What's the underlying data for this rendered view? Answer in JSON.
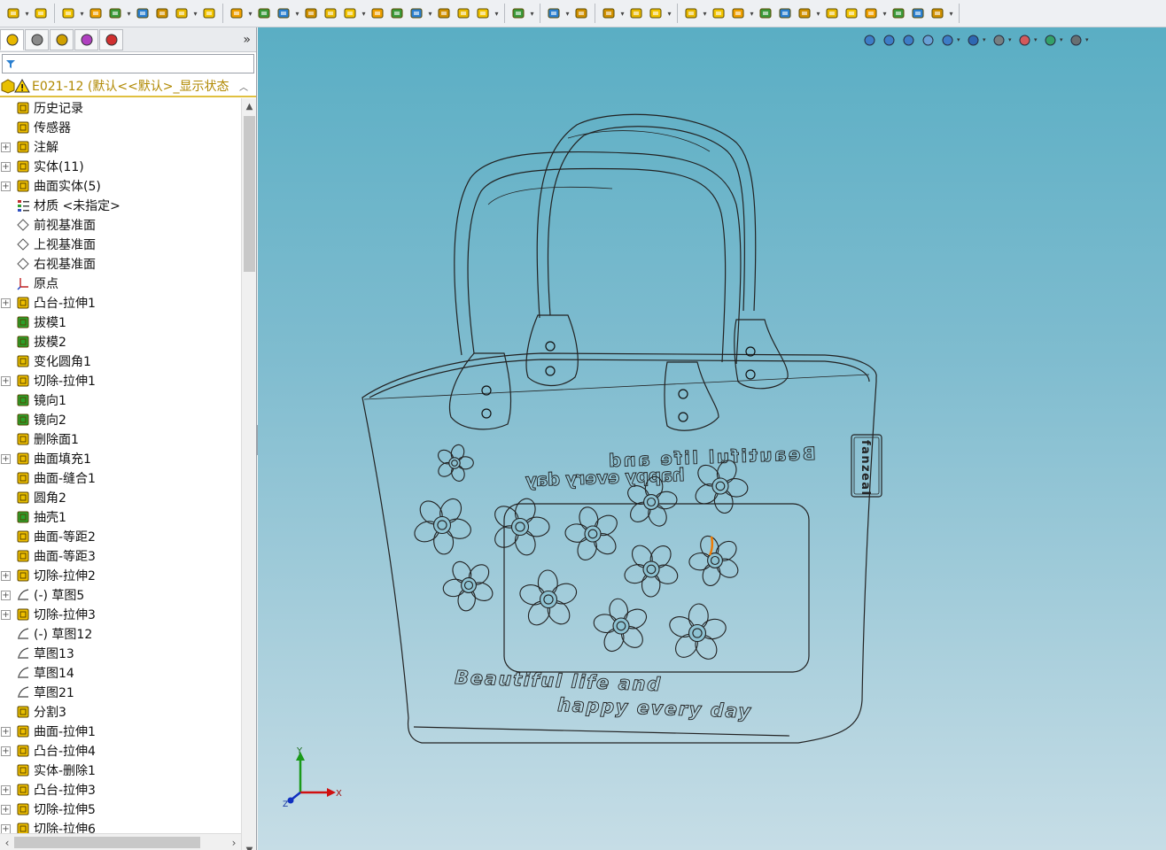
{
  "window": {
    "colors": {
      "viewport_top": "#5aaec4",
      "viewport_bottom": "#c6dde6",
      "root_text": "#b08800",
      "accent_yellow": "#e8c000"
    }
  },
  "toolbar": {
    "groups": [
      [
        "new-document-icon",
        "open-document-icon"
      ],
      [
        "sketch-point-icon",
        "extrude-boss-icon",
        "revolve-boss-icon",
        "sweep-boss-icon",
        "loft-boss-icon",
        "boundary-boss-icon",
        "fillet-icon"
      ],
      [
        "chamfer-icon",
        "rib-icon",
        "shell-icon",
        "draft-icon",
        "dome-icon",
        "wrap-icon",
        "intersect-icon",
        "cut-extrude-icon",
        "cut-revolve-icon",
        "hole-wizard-icon",
        "thread-icon",
        "mirror-icon"
      ],
      [
        "linear-pattern-icon"
      ],
      [
        "reference-geometry-icon",
        "curves-icon"
      ],
      [
        "smart-dimension-icon",
        "spline-icon",
        "instant3d-icon"
      ],
      [
        "sketch-icon",
        "smart-dim-icon",
        "line-icon",
        "rectangle-icon",
        "slot-icon",
        "circle-icon",
        "arc-icon",
        "spline-tool-icon",
        "ellipse-icon",
        "trim-icon",
        "point-icon",
        "centerline-icon"
      ]
    ]
  },
  "left_panel": {
    "tabs": [
      "feature-manager-icon",
      "property-manager-icon",
      "configuration-manager-icon",
      "dimxpert-icon",
      "display-manager-icon"
    ],
    "collapse_glyph": "»",
    "filter_icon": "filter-icon",
    "root": {
      "label": "E021-12  (默认<<默认>_显示状态",
      "icon": "part-warning-icon"
    },
    "items": [
      {
        "label": "历史记录",
        "icon": "history-icon",
        "expandable": false
      },
      {
        "label": "传感器",
        "icon": "sensor-icon",
        "expandable": false
      },
      {
        "label": "注解",
        "icon": "annotation-icon",
        "expandable": true
      },
      {
        "label": "实体(11)",
        "icon": "solid-bodies-icon",
        "expandable": true
      },
      {
        "label": "曲面实体(5)",
        "icon": "surface-bodies-icon",
        "expandable": true
      },
      {
        "label": "材质 <未指定>",
        "icon": "material-icon",
        "expandable": false
      },
      {
        "label": "前视基准面",
        "icon": "plane-icon",
        "expandable": false
      },
      {
        "label": "上视基准面",
        "icon": "plane-icon",
        "expandable": false
      },
      {
        "label": "右视基准面",
        "icon": "plane-icon",
        "expandable": false
      },
      {
        "label": "原点",
        "icon": "origin-icon",
        "expandable": false
      },
      {
        "label": "凸台-拉伸1",
        "icon": "extrude-boss-icon",
        "expandable": true
      },
      {
        "label": "拔模1",
        "icon": "draft-icon",
        "expandable": false
      },
      {
        "label": "拔模2",
        "icon": "draft-icon",
        "expandable": false
      },
      {
        "label": "变化圆角1",
        "icon": "variable-fillet-icon",
        "expandable": false
      },
      {
        "label": "切除-拉伸1",
        "icon": "cut-extrude-icon",
        "expandable": true
      },
      {
        "label": "镜向1",
        "icon": "mirror-icon",
        "expandable": false
      },
      {
        "label": "镜向2",
        "icon": "mirror-icon",
        "expandable": false
      },
      {
        "label": "删除面1",
        "icon": "delete-face-icon",
        "expandable": false
      },
      {
        "label": "曲面填充1",
        "icon": "surface-fill-icon",
        "expandable": true
      },
      {
        "label": "曲面-缝合1",
        "icon": "surface-knit-icon",
        "expandable": false
      },
      {
        "label": "圆角2",
        "icon": "fillet-icon",
        "expandable": false
      },
      {
        "label": "抽壳1",
        "icon": "shell-icon",
        "expandable": false
      },
      {
        "label": "曲面-等距2",
        "icon": "surface-offset-icon",
        "expandable": false
      },
      {
        "label": "曲面-等距3",
        "icon": "surface-offset-icon",
        "expandable": false
      },
      {
        "label": "切除-拉伸2",
        "icon": "cut-extrude-icon",
        "expandable": true
      },
      {
        "label": "(-) 草图5",
        "icon": "sketch-icon",
        "expandable": true
      },
      {
        "label": "切除-拉伸3",
        "icon": "cut-extrude-icon",
        "expandable": true
      },
      {
        "label": "(-) 草图12",
        "icon": "sketch-icon",
        "expandable": false
      },
      {
        "label": "草图13",
        "icon": "sketch-icon",
        "expandable": false
      },
      {
        "label": "草图14",
        "icon": "sketch-icon",
        "expandable": false
      },
      {
        "label": "草图21",
        "icon": "sketch-icon",
        "expandable": false
      },
      {
        "label": "分割3",
        "icon": "split-icon",
        "expandable": false
      },
      {
        "label": "曲面-拉伸1",
        "icon": "surface-extrude-icon",
        "expandable": true
      },
      {
        "label": "凸台-拉伸4",
        "icon": "extrude-boss-icon",
        "expandable": true
      },
      {
        "label": "实体-删除1",
        "icon": "delete-body-icon",
        "expandable": false
      },
      {
        "label": "凸台-拉伸3",
        "icon": "extrude-boss-icon",
        "expandable": true
      },
      {
        "label": "切除-拉伸5",
        "icon": "cut-extrude-icon",
        "expandable": true
      },
      {
        "label": "切除-拉伸6",
        "icon": "cut-extrude-icon",
        "expandable": true
      }
    ]
  },
  "viewport": {
    "view_toolbar": [
      "zoom-to-fit-icon",
      "zoom-area-icon",
      "previous-view-icon",
      "section-view-icon",
      "view-orientation-icon",
      "display-style-icon",
      "hide-show-icon",
      "appearance-icon",
      "scene-icon",
      "view-settings-icon"
    ],
    "model_text": {
      "front_line1": "Beautiful life and",
      "front_line2": "happy every day",
      "back_line1": "Beautiful life and",
      "back_line2": "happy every day",
      "side_label": "fanzeal"
    },
    "triad": {
      "x": "X",
      "y": "Y",
      "z": "Z"
    }
  }
}
